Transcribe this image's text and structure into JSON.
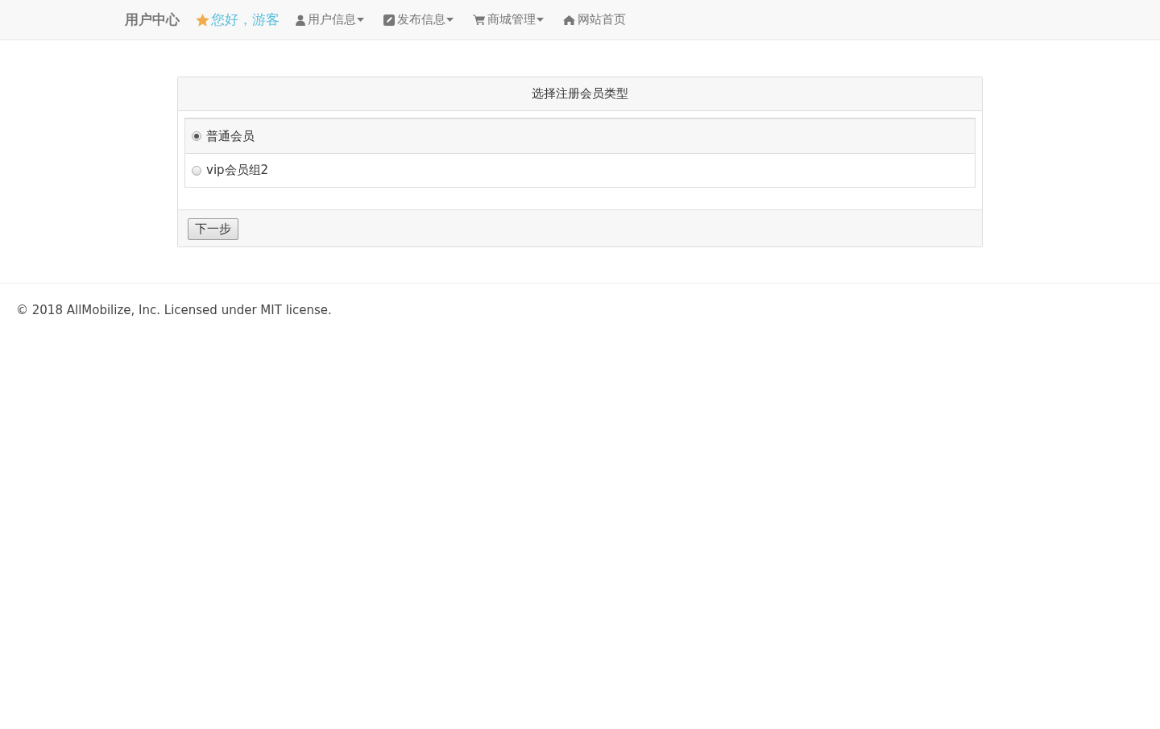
{
  "navbar": {
    "brand": "用户中心",
    "greeting": "您好，游客",
    "items": [
      {
        "label": "用户信息",
        "dropdown": true
      },
      {
        "label": "发布信息",
        "dropdown": true
      },
      {
        "label": "商城管理",
        "dropdown": true
      },
      {
        "label": "网站首页",
        "dropdown": false
      }
    ]
  },
  "panel": {
    "title": "选择注册会员类型",
    "options": [
      {
        "label": "普通会员",
        "selected": true
      },
      {
        "label": "vip会员组2",
        "selected": false
      }
    ],
    "button": "下一步"
  },
  "footer": "© 2018 AllMobilize, Inc. Licensed under MIT license."
}
